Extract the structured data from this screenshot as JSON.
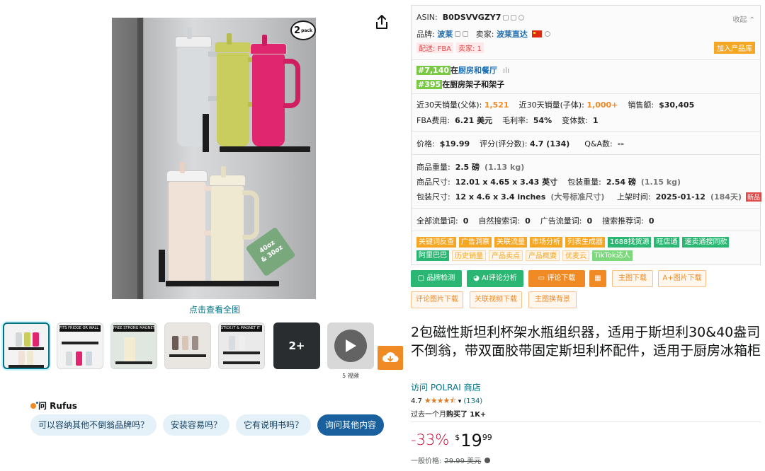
{
  "gallery": {
    "view_full": "点击查看全图",
    "pack_count": "2",
    "pack_unit": "pack",
    "size_tag_line1": "40oz",
    "size_tag_line2": "& 30oz",
    "thumb_captions": [
      "FITS FRIDGE OR WALL",
      "",
      "FREE STRONG MAGNET",
      "",
      "STICK IT & MAGNET IT",
      "",
      ""
    ],
    "more_count": "2+",
    "video_count": "5 视频"
  },
  "rufus": {
    "title": "问 Rufus",
    "chips": [
      "可以容纳其他不倒翁品牌吗？",
      "安装容易吗？",
      "它有说明书吗？",
      "询问其他内容"
    ]
  },
  "plugin": {
    "asin_label": "ASIN:",
    "asin": "B0DSVVGZY7",
    "collapse": "收起 ⌃",
    "brand_label": "品牌:",
    "brand": "波莱",
    "seller_label": "卖家:",
    "seller": "波莱直达",
    "ship_label": "配送:",
    "ship_method": "FBA",
    "seller_count": "卖家: 1",
    "add_lib": "加入产品库",
    "rank1": "#7,140",
    "rank1_pre": "在",
    "rank1_cat": "厨房和餐厅",
    "rank2": "#395",
    "rank2_pre": "在",
    "rank2_cat": "厨房架子和架子",
    "sales30_parent_label": "近30天销量(父体):",
    "sales30_parent": "1,521",
    "sales30_child_label": "近30天销量(子体):",
    "sales30_child": "1,000+",
    "revenue_label": "销售额:",
    "revenue": "$30,405",
    "fba_label": "FBA费用:",
    "fba": "6.21 美元",
    "margin_label": "毛利率:",
    "margin": "54%",
    "variants_label": "变体数:",
    "variants": "1",
    "price_label": "价格:",
    "price": "$19.99",
    "score_label": "评分(评分数):",
    "score": "4.7 (134)",
    "qa_label": "Q&A数:",
    "qa": "--",
    "weight_label": "商品重量:",
    "weight": "2.5 磅",
    "weight_kg": "(1.13 kg)",
    "dims_label": "商品尺寸:",
    "dims": "12.01 x 4.65 x 3.43 英寸",
    "pkg_weight_label": "包装重量:",
    "pkg_weight": "2.54 磅",
    "pkg_weight_kg": "(1.15 kg)",
    "pkg_dims_label": "包装尺寸:",
    "pkg_dims": "12 x 4.6 x 3.4 inches",
    "pkg_dims_class": "(大号标准尺寸)",
    "launch_label": "上架时间:",
    "launch": "2025-01-12",
    "launch_days": "(184天)",
    "new_badge": "新品",
    "traffic_all_label": "全部流量词:",
    "traffic_all": "0",
    "organic_label": "自然搜索词:",
    "organic": "0",
    "ad_label": "广告流量词:",
    "ad": "0",
    "recommend_label": "搜索推荐词:",
    "recommend": "0",
    "tools": [
      {
        "label": "关键词反查",
        "style": "o"
      },
      {
        "label": "广告洞察",
        "style": "o"
      },
      {
        "label": "关联流量",
        "style": "o"
      },
      {
        "label": "市场分析",
        "style": "o"
      },
      {
        "label": "列表生成器",
        "style": "o"
      },
      {
        "label": "1688找货源",
        "style": "g"
      },
      {
        "label": "旺店通",
        "style": "g"
      },
      {
        "label": "速卖通搜同款",
        "style": "g"
      },
      {
        "label": "阿里巴巴",
        "style": "g"
      },
      {
        "label": "历史销量",
        "style": "lo"
      },
      {
        "label": "产品卖点",
        "style": "lo"
      },
      {
        "label": "产品概要",
        "style": "lo"
      },
      {
        "label": "优麦云",
        "style": "lo"
      },
      {
        "label": "TikTok达人",
        "style": "lg"
      }
    ]
  },
  "actions": {
    "brand_check": "品牌检测",
    "ai_review": "AI评论分析",
    "review_download": "评论下载",
    "main_img_download": "主图下载",
    "aplus_download": "A+图片下载",
    "review_img_download": "评论图片下载",
    "video_download": "关联视频下载",
    "main_img_bg": "主图换背景"
  },
  "product": {
    "title": "2包磁性斯坦利杯架水瓶组织器，适用于斯坦利30&40盎司不倒翁，带双面胶带固定斯坦利杯配件，适用于厨房冰箱柜",
    "store": "访问 POLRAI 商店",
    "rating": "4.7",
    "stars": "★★★★⯪",
    "rating_count": "(134)",
    "bought_prefix": "过去一个月",
    "bought_mid": "购买了",
    "bought_count": "1K+",
    "discount": "-33%",
    "currency": "$",
    "price_whole": "19",
    "price_cents": "99",
    "list_price_label": "一般价格:",
    "list_price": "29.99 美元",
    "rating_value": 4.7
  },
  "colors": {
    "accent_orange": "#f08a24",
    "accent_green": "#2bb673",
    "link": "#007185",
    "discount": "#cc0c39",
    "rufus_primary": "#1a5f9e"
  }
}
